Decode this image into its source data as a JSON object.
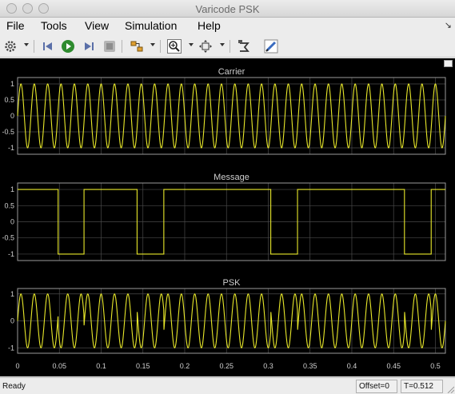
{
  "window": {
    "title": "Varicode  PSK"
  },
  "menu": {
    "items": [
      "File",
      "Tools",
      "View",
      "Simulation",
      "Help"
    ]
  },
  "colors": {
    "trace": "#e8e82a",
    "axes_bg": "#000000",
    "grid": "#4a4a4a",
    "text": "#cfcfcf"
  },
  "toolbar": {
    "icons": [
      "gear-icon",
      "step-back-icon",
      "run-icon",
      "step-forward-icon",
      "stop-icon",
      "highlight-block-icon",
      "zoom-in-icon",
      "fit-to-view-icon",
      "autoscale-icon",
      "edit-icon"
    ]
  },
  "status": {
    "ready": "Ready",
    "offset": "Offset=0",
    "time": "T=0.512"
  },
  "chart_data": [
    {
      "type": "line",
      "title": "Carrier",
      "signal": "sine",
      "frequency_hz": 62.5,
      "amplitude": 1,
      "yticks": [
        "1",
        "0.5",
        "0",
        "-0.5",
        "-1"
      ],
      "ylim": [
        -1.2,
        1.2
      ],
      "xlim": [
        0,
        0.512
      ],
      "grid": true
    },
    {
      "type": "line",
      "title": "Message",
      "signal": "square",
      "steps": [
        {
          "x": 0,
          "y": 1
        },
        {
          "x": 0.0485,
          "y": -1
        },
        {
          "x": 0.0795,
          "y": 1
        },
        {
          "x": 0.143,
          "y": -1
        },
        {
          "x": 0.175,
          "y": 1
        },
        {
          "x": 0.303,
          "y": -1
        },
        {
          "x": 0.335,
          "y": 1
        },
        {
          "x": 0.463,
          "y": -1
        },
        {
          "x": 0.495,
          "y": 1
        }
      ],
      "yticks": [
        "1",
        "0.5",
        "0",
        "-0.5",
        "-1"
      ],
      "ylim": [
        -1.2,
        1.2
      ],
      "xlim": [
        0,
        0.512
      ],
      "grid": true
    },
    {
      "type": "line",
      "title": "PSK",
      "signal": "carrier x message",
      "yticks": [
        "1",
        "0",
        "-1"
      ],
      "ylim": [
        -1.2,
        1.2
      ],
      "xlim": [
        0,
        0.512
      ],
      "xticks": [
        "0",
        "0.05",
        "0.1",
        "0.15",
        "0.2",
        "0.25",
        "0.3",
        "0.35",
        "0.4",
        "0.45",
        "0.5"
      ],
      "xtick_values": [
        0,
        0.05,
        0.1,
        0.15,
        0.2,
        0.25,
        0.3,
        0.35,
        0.4,
        0.45,
        0.5
      ],
      "grid": true
    }
  ]
}
